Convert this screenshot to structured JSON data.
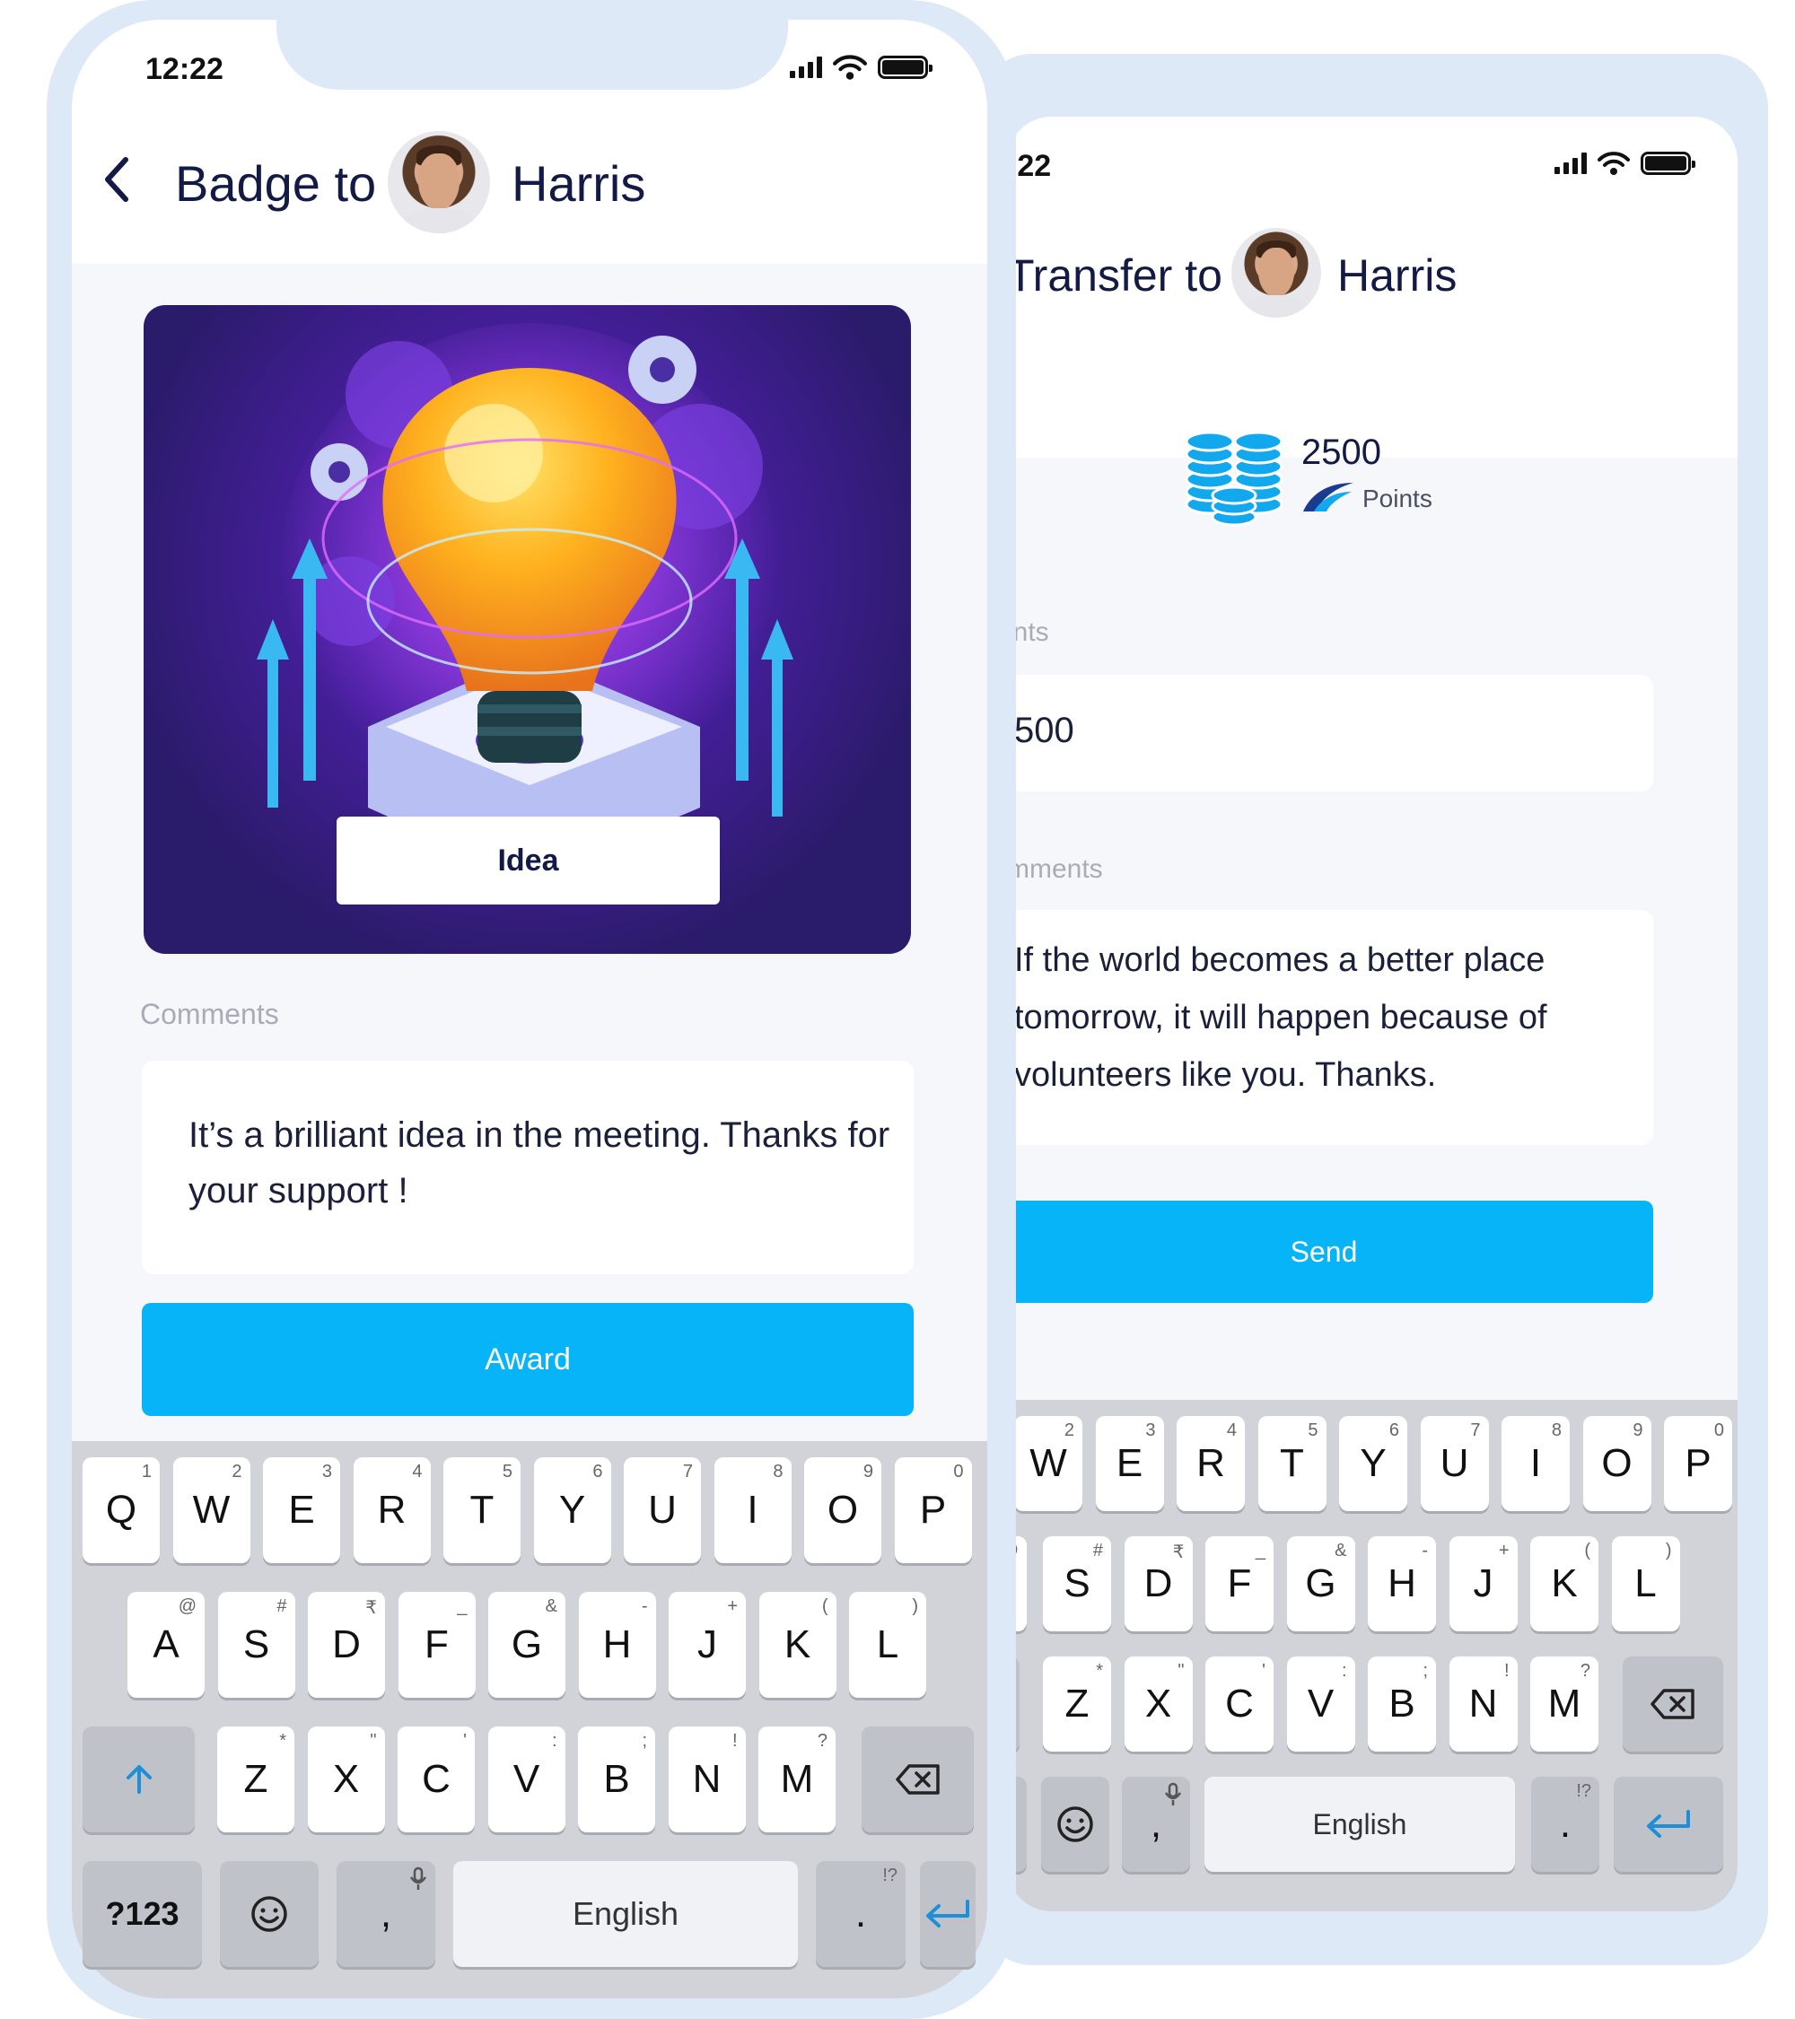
{
  "left_phone": {
    "status_time": "12:22",
    "back_icon": "chevron-left-icon",
    "title_prefix": "Badge to",
    "recipient_name": "Harris",
    "badge_label": "Idea",
    "comments_label": "Comments",
    "comment_text": "It’s a brilliant idea in the meeting. Thanks for your support !",
    "action_button": "Award",
    "keyboard": {
      "row1": [
        {
          "k": "Q",
          "h": "1"
        },
        {
          "k": "W",
          "h": "2"
        },
        {
          "k": "E",
          "h": "3"
        },
        {
          "k": "R",
          "h": "4"
        },
        {
          "k": "T",
          "h": "5"
        },
        {
          "k": "Y",
          "h": "6"
        },
        {
          "k": "U",
          "h": "7"
        },
        {
          "k": "I",
          "h": "8"
        },
        {
          "k": "O",
          "h": "9"
        },
        {
          "k": "P",
          "h": "0"
        }
      ],
      "row2": [
        {
          "k": "A",
          "h": "@"
        },
        {
          "k": "S",
          "h": "#"
        },
        {
          "k": "D",
          "h": "₹"
        },
        {
          "k": "F",
          "h": "_"
        },
        {
          "k": "G",
          "h": "&"
        },
        {
          "k": "H",
          "h": "-"
        },
        {
          "k": "J",
          "h": "+"
        },
        {
          "k": "K",
          "h": "("
        },
        {
          "k": "L",
          "h": ")"
        }
      ],
      "row3": [
        {
          "k": "Z",
          "h": "*"
        },
        {
          "k": "X",
          "h": "\""
        },
        {
          "k": "C",
          "h": "'"
        },
        {
          "k": "V",
          "h": ":"
        },
        {
          "k": "B",
          "h": ";"
        },
        {
          "k": "N",
          "h": "!"
        },
        {
          "k": "M",
          "h": "?"
        }
      ],
      "shift_icon": "arrow-up-icon",
      "backspace_icon": "backspace-icon",
      "symbols_key": "?123",
      "emoji_icon": "smiley-icon",
      "comma_key": ",",
      "mic_icon": "microphone-icon",
      "space_label": "English",
      "period_key": ".",
      "period_hint": "!?",
      "enter_icon": "return-arrow-icon"
    }
  },
  "right_phone": {
    "status_time": ":22",
    "title_prefix": "Transfer to",
    "recipient_name": "Harris",
    "balance_value": "2500",
    "balance_unit": "Points",
    "coins_icon": "coin-stack-icon",
    "points_label": "ints",
    "points_value": "500",
    "comments_label": "mments",
    "comment_text": "If the world becomes a better place tomorrow, it will happen because of volunteers like you. Thanks.",
    "action_button": "Send",
    "keyboard": {
      "row1": [
        {
          "k": "W",
          "h": "2"
        },
        {
          "k": "E",
          "h": "3"
        },
        {
          "k": "R",
          "h": "4"
        },
        {
          "k": "T",
          "h": "5"
        },
        {
          "k": "Y",
          "h": "6"
        },
        {
          "k": "U",
          "h": "7"
        },
        {
          "k": "I",
          "h": "8"
        },
        {
          "k": "O",
          "h": "9"
        },
        {
          "k": "P",
          "h": "0"
        }
      ],
      "row2": [
        {
          "k": "S",
          "h": "#"
        },
        {
          "k": "D",
          "h": "₹"
        },
        {
          "k": "F",
          "h": "_"
        },
        {
          "k": "G",
          "h": "&"
        },
        {
          "k": "H",
          "h": "-"
        },
        {
          "k": "J",
          "h": "+"
        },
        {
          "k": "K",
          "h": "("
        },
        {
          "k": "L",
          "h": ")"
        }
      ],
      "row3": [
        {
          "k": "Z",
          "h": "*"
        },
        {
          "k": "X",
          "h": "\""
        },
        {
          "k": "C",
          "h": "'"
        },
        {
          "k": "V",
          "h": ":"
        },
        {
          "k": "B",
          "h": ";"
        },
        {
          "k": "N",
          "h": "!"
        },
        {
          "k": "M",
          "h": "?"
        }
      ],
      "partial_row2_hint": "@",
      "backspace_icon": "backspace-icon",
      "emoji_icon": "smiley-icon",
      "comma_key": ",",
      "mic_icon": "microphone-icon",
      "space_label": "English",
      "period_key": ".",
      "period_hint": "!?",
      "enter_icon": "return-arrow-icon"
    }
  },
  "colors": {
    "accent": "#07b4f8",
    "title": "#141a46",
    "muted": "#a8acb8",
    "shell": "#dde9f6"
  }
}
